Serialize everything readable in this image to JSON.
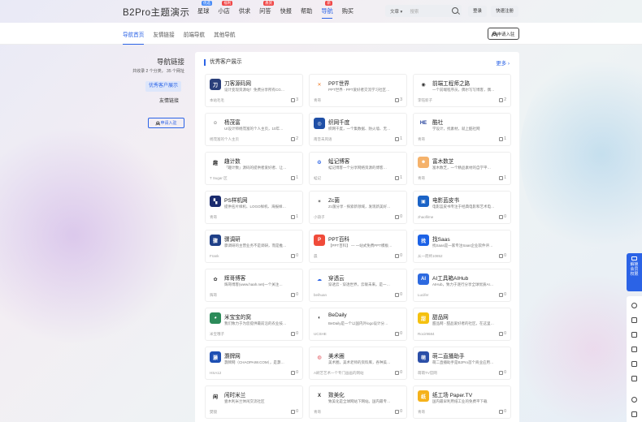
{
  "site": {
    "logo": "B2Pro主题演示",
    "nav": [
      {
        "label": "星球",
        "badge": "优选",
        "badge_color": "#4a8cf7"
      },
      {
        "label": "小店",
        "badge": "福利",
        "badge_color": "#f04848"
      },
      {
        "label": "供求",
        "badge": "",
        "badge_color": ""
      },
      {
        "label": "问答",
        "badge": "悬赏",
        "badge_color": "#f04848"
      },
      {
        "label": "快报",
        "badge": "",
        "badge_color": ""
      },
      {
        "label": "帮助",
        "badge": "",
        "badge_color": ""
      },
      {
        "label": "导航",
        "badge": "新",
        "badge_color": "#f04848",
        "active": true
      },
      {
        "label": "购买",
        "badge": "",
        "badge_color": ""
      }
    ],
    "search_select": "文章",
    "search_placeholder": "搜索",
    "login_label": "登录",
    "register_label": "快速注册"
  },
  "subnav": {
    "items": [
      "导航首页",
      "友情链接",
      "前端导航",
      "其他导航"
    ],
    "apply_label": "申请入驻"
  },
  "sidebar": {
    "title": "导航链接",
    "subtitle": "共收录 2 个分类， 35 个网址",
    "items": [
      "优秀客户展示",
      "友情链接"
    ],
    "apply_label": "申请入驻"
  },
  "section": {
    "title": "优秀客户展示",
    "more_label": "更多"
  },
  "cards": [
    {
      "name": "刀客源码网",
      "desc": "设计变现资源站！免费分享所有CG…",
      "author": "本站毛毛",
      "likes": "3",
      "icon_text": "刀",
      "icon_bg": "#2a3f7a"
    },
    {
      "name": "PPT世界",
      "desc": "PPT世界 - PPT爱好者交流学习社区…",
      "author": "青哥",
      "likes": "3",
      "icon_text": "✕",
      "icon_bg": "#ffffff",
      "icon_color": "#f07d2a"
    },
    {
      "name": "前端工程师之路",
      "desc": "一个前端程序员，偶尔写写博客，偶…",
      "author": "李钰新子",
      "likes": "2",
      "icon_text": "◉",
      "icon_bg": "#ffffff",
      "icon_color": "#333333"
    },
    {
      "name": "杨茂富",
      "desc": "UI设计师杨茂富的个人主页，10年…",
      "author": "杨茂富的个人主页",
      "likes": "2",
      "icon_text": "☺",
      "icon_bg": "#ffffff",
      "icon_color": "#333333"
    },
    {
      "name": "织网千度",
      "desc": "织网千度，一个集数据、防火墙、无…",
      "author": "南音未风语",
      "likes": "1",
      "icon_text": "◎",
      "icon_bg": "#1f4fa6"
    },
    {
      "name": "酷社",
      "desc": "学设计，找素材，就上酷社网",
      "author": "青哥",
      "likes": "1",
      "icon_text": "HE",
      "icon_bg": "#ffffff",
      "icon_color": "#1e3c9a"
    },
    {
      "name": "趣计数",
      "desc": "「趣计数」源码的提供者爱好者、让…",
      "author": "T Sugar 区",
      "likes": "1",
      "icon_text": "趣",
      "icon_bg": "#ffffff",
      "icon_color": "#333333"
    },
    {
      "name": "蜢记博客",
      "desc": "蜢记博客一个分享网络资源的博客…",
      "author": "蜢记",
      "likes": "1",
      "icon_text": "❂",
      "icon_bg": "#ffffff",
      "icon_color": "#2b63e6"
    },
    {
      "name": "富木数芝",
      "desc": "富木数芝，一个精品素材的自学平…",
      "author": "青哥",
      "likes": "1",
      "icon_text": "☻",
      "icon_bg": "#f5b26b"
    },
    {
      "name": "PS样机网",
      "desc": "提供名片样机、LOGO样机、海报样…",
      "author": "青哥",
      "likes": "1",
      "icon_text": "▚",
      "icon_bg": "#1a2b6e"
    },
    {
      "name": "Zc菌",
      "desc": "Zc菌分享 - 探索新领域，发现新美好…",
      "author": "小葫子",
      "likes": "0",
      "icon_text": "✶",
      "icon_bg": "#ffffff",
      "icon_color": "#555555"
    },
    {
      "name": "电影蓝皮书",
      "desc": "电影蓝皮书专注于经典电影和艺术电…",
      "author": "zhaofilme",
      "likes": "0",
      "icon_text": "▣",
      "icon_bg": "#1b63c6"
    },
    {
      "name": "骤调研",
      "desc": "骤调研的主营业务不是调研，而是推…",
      "author": "Frank",
      "likes": "0",
      "icon_text": "骤",
      "icon_bg": "#1e3f87"
    },
    {
      "name": "PPT百科",
      "desc": "【PPT百科】 — 一站式免费PPT模板…",
      "author": "晨",
      "likes": "0",
      "icon_text": "P",
      "icon_bg": "#f04b3a"
    },
    {
      "name": "找Saas",
      "desc": "找Saas是一家专注Saas企业软件评…",
      "author": "从一而终10852",
      "likes": "0",
      "icon_text": "找",
      "icon_bg": "#1c62e6"
    },
    {
      "name": "辉哥博客",
      "desc": "辉哥博客(www.haah.net)一个关注…",
      "author": "辉哥",
      "likes": "0",
      "icon_text": "✿",
      "icon_bg": "#ffffff",
      "icon_color": "#333333"
    },
    {
      "name": "穿透云",
      "desc": "穿透云 - 穿透世界，云联未来。是一…",
      "author": "beihuan",
      "likes": "0",
      "icon_text": "☁",
      "icon_bg": "#ffffff",
      "icon_color": "#2b63e6"
    },
    {
      "name": "AI工具箱AIHub",
      "desc": "AIHub，致力于逐行分享全球优质AI…",
      "author": "Lucifer",
      "likes": "0",
      "icon_text": "AI",
      "icon_bg": "#2d6ae0"
    },
    {
      "name": "米宝宝的窝",
      "desc": "我们致力于为您提供最前沿的农业技…",
      "author": "米宝哦子",
      "likes": "0",
      "icon_text": "◕",
      "icon_bg": "#2c8b5a"
    },
    {
      "name": "BeDaily",
      "desc": "BeDaily是一个以国内外logo设计分…",
      "author": "UCSHE",
      "likes": "0",
      "icon_text": "◐",
      "icon_bg": "#ffffff",
      "icon_color": "#222222"
    },
    {
      "name": "甜品网",
      "desc": "甜品网 - 甜品爱好者的社区，在这里…",
      "author": "Rocir9684",
      "likes": "0",
      "icon_text": "甜",
      "icon_bg": "#f5c10f"
    },
    {
      "name": "灏牌网",
      "desc": "灏牌网（CHAOPAIW.COM），是灏…",
      "author": "HSA12",
      "likes": "0",
      "icon_text": "灏",
      "icon_bg": "#1d4fb3"
    },
    {
      "name": "美术圈",
      "desc": "美术圈，美术老师的资料库，各种美…",
      "author": "A刷艺艺术一个专门画画的网站",
      "likes": "0",
      "icon_text": "◍",
      "icon_bg": "#ffffff",
      "icon_color": "#e0525a"
    },
    {
      "name": "萌二直播助手",
      "desc": "萌二直播助手是B2Pro首个商业应用…",
      "author": "萌萌TV官网",
      "likes": "0",
      "icon_text": "萌",
      "icon_bg": "#2b4fa8"
    },
    {
      "name": "闲时米兰",
      "desc": "壹木利米兰休闲交流社区",
      "author": "樊镜",
      "likes": "0",
      "icon_text": "闲",
      "icon_bg": "#ffffff",
      "icon_color": "#222222"
    },
    {
      "name": "致美化",
      "desc": "致美化是全球网站下网站。国内最专…",
      "author": "青哥",
      "likes": "0",
      "icon_text": "X",
      "icon_bg": "#ffffff",
      "icon_color": "#2a2a2a"
    },
    {
      "name": "纸工场 Paper.TV",
      "desc": "国内最早利用纸工业的免费平下载",
      "author": "青哥",
      "likes": "0",
      "icon_text": "纸",
      "icon_bg": "#f5b21b"
    }
  ],
  "float_bar": {
    "top_label": "解锁会员权限"
  }
}
